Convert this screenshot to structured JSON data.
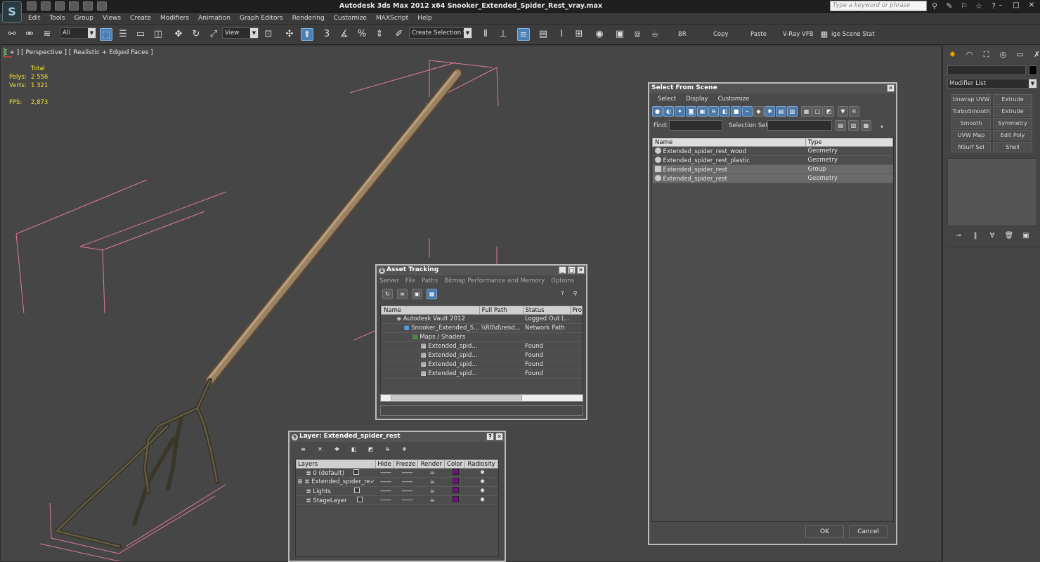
{
  "app": {
    "logo": "S",
    "title": "Autodesk 3ds Max  2012 x64      Snooker_Extended_Spider_Rest_vray.max",
    "search_placeholder": "Type a keyword or phrase"
  },
  "menu": [
    "Edit",
    "Tools",
    "Group",
    "Views",
    "Create",
    "Modifiers",
    "Animation",
    "Graph Editors",
    "Rendering",
    "Customize",
    "MAXScript",
    "Help"
  ],
  "toolbar": {
    "selection_filter": "All",
    "ref_coord": "View",
    "snap_3": "3",
    "named_selection": "Create Selection Se",
    "br_label": "BR",
    "copy_label": "Copy",
    "paste_label": "Paste",
    "vray_label": "V-Ray VFB",
    "stage_label": "ige Scene Stat"
  },
  "viewport": {
    "label": "[ + ] [ Perspective ] [ Realistic + Edged Faces ]",
    "stats": {
      "total_label": "Total",
      "polys_label": "Polys:",
      "polys": "2 556",
      "verts_label": "Verts:",
      "verts": "1 321",
      "fps_label": "FPS:",
      "fps": "2,873"
    }
  },
  "command_panel": {
    "modifier_list": "Modifier List",
    "buttons": [
      "Unwrap UVW",
      "Extrude",
      "TurboSmooth",
      "Extrude",
      "Smooth",
      "Symmetry",
      "UVW Map",
      "Edit Poly",
      "NSurf Sel",
      "Shell"
    ]
  },
  "select_from_scene": {
    "title": "Select From Scene",
    "menu": [
      "Select",
      "Display",
      "Customize"
    ],
    "find_label": "Find:",
    "selection_set_label": "Selection Set:",
    "columns": [
      "Name",
      "Type"
    ],
    "rows": [
      {
        "name": "Extended_spider_rest_wood",
        "type": "Geometry"
      },
      {
        "name": "Extended_spider_rest_plastic",
        "type": "Geometry"
      },
      {
        "name": "Extended_spider_rest",
        "type": "Group"
      },
      {
        "name": "Extended_spider_rest",
        "type": "Geometry"
      }
    ],
    "ok": "OK",
    "cancel": "Cancel"
  },
  "asset_tracking": {
    "title": "Asset Tracking",
    "menu": [
      "Server",
      "File",
      "Paths",
      "Bitmap Performance and Memory",
      "Options"
    ],
    "columns": [
      "Name",
      "Full Path",
      "Status",
      "Pro"
    ],
    "rows": [
      {
        "name": "Autodesk Vault 2012",
        "path": "",
        "status": "Logged Out (..."
      },
      {
        "name": "Snooker_Extended_S...",
        "path": "\\\\R0\\d\\rend...",
        "status": "Network Path"
      },
      {
        "name": "Maps / Shaders",
        "path": "",
        "status": ""
      },
      {
        "name": "Extended_spid...",
        "path": "",
        "status": "Found"
      },
      {
        "name": "Extended_spid...",
        "path": "",
        "status": "Found"
      },
      {
        "name": "Extended_spid...",
        "path": "",
        "status": "Found"
      },
      {
        "name": "Extended_spid...",
        "path": "",
        "status": "Found"
      }
    ]
  },
  "layer_dialog": {
    "title": "Layer: Extended_spider_rest",
    "columns": [
      "Layers",
      "Hide",
      "Freeze",
      "Render",
      "Color",
      "Radiosity"
    ],
    "rows": [
      {
        "name": "0 (default)"
      },
      {
        "name": "Extended_spider_re"
      },
      {
        "name": "Lights"
      },
      {
        "name": "StageLayer"
      }
    ]
  }
}
